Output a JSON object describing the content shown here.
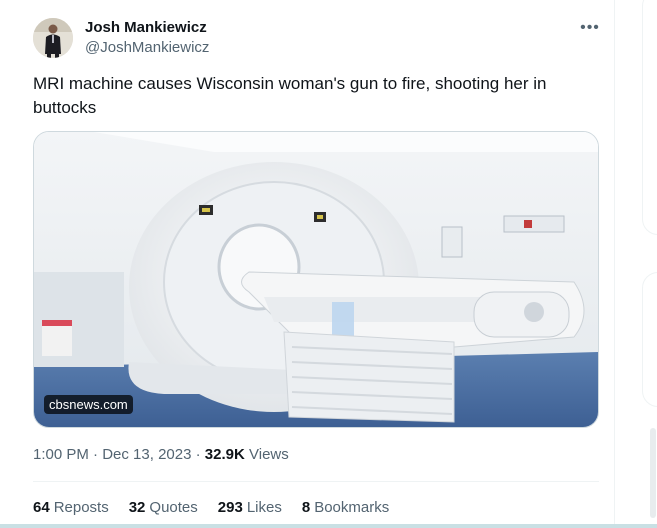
{
  "author": {
    "display_name": "Josh Mankiewicz",
    "handle": "@JoshMankiewicz"
  },
  "more_icon": "more-horizontal-icon",
  "tweet": {
    "text": "MRI machine causes Wisconsin woman's gun to fire, shooting her in buttocks"
  },
  "media": {
    "source_badge": "cbsnews.com"
  },
  "meta": {
    "time": "1:00 PM",
    "separator1": " · ",
    "date": "Dec 13, 2023",
    "separator2": " · ",
    "views_count": "32.9K",
    "views_label": "Views"
  },
  "stats": [
    {
      "count": "64",
      "label": "Reposts"
    },
    {
      "count": "32",
      "label": "Quotes"
    },
    {
      "count": "293",
      "label": "Likes"
    },
    {
      "count": "8",
      "label": "Bookmarks"
    }
  ],
  "colors": {
    "text_primary": "#0f1419",
    "text_secondary": "#536471",
    "border": "#eff3f4"
  }
}
